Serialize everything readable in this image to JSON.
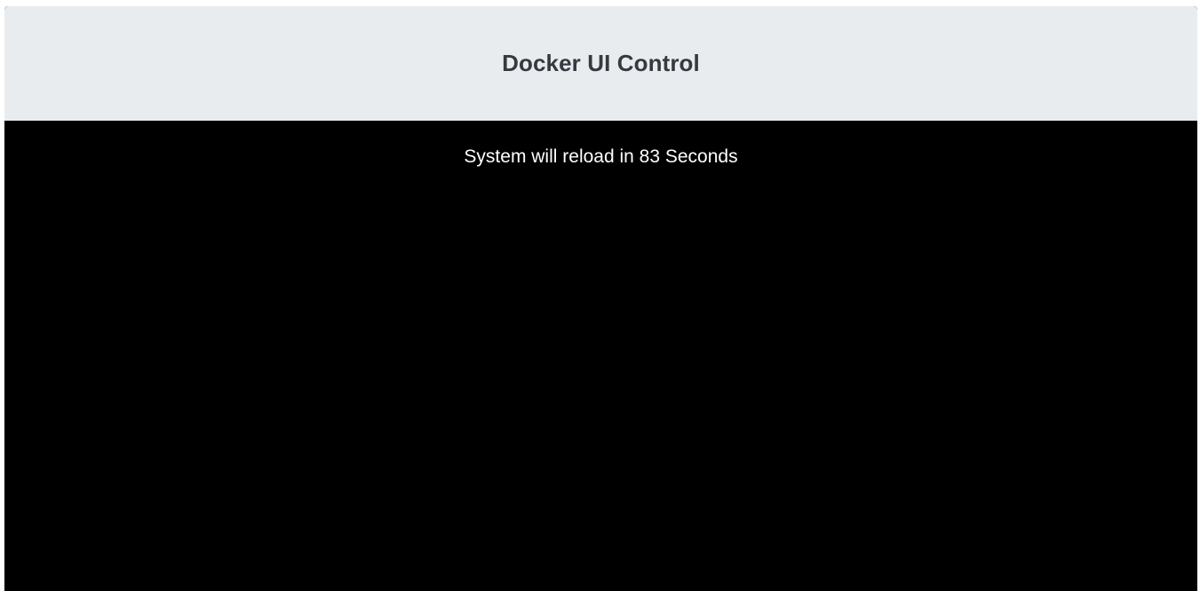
{
  "header": {
    "title": "Docker UI Control"
  },
  "main": {
    "reload_message": "System will reload in 83 Seconds",
    "countdown_seconds": 83
  },
  "colors": {
    "header_background": "#e9ecef",
    "header_text": "#343a40",
    "main_background": "#000000",
    "main_text": "#ffffff"
  }
}
